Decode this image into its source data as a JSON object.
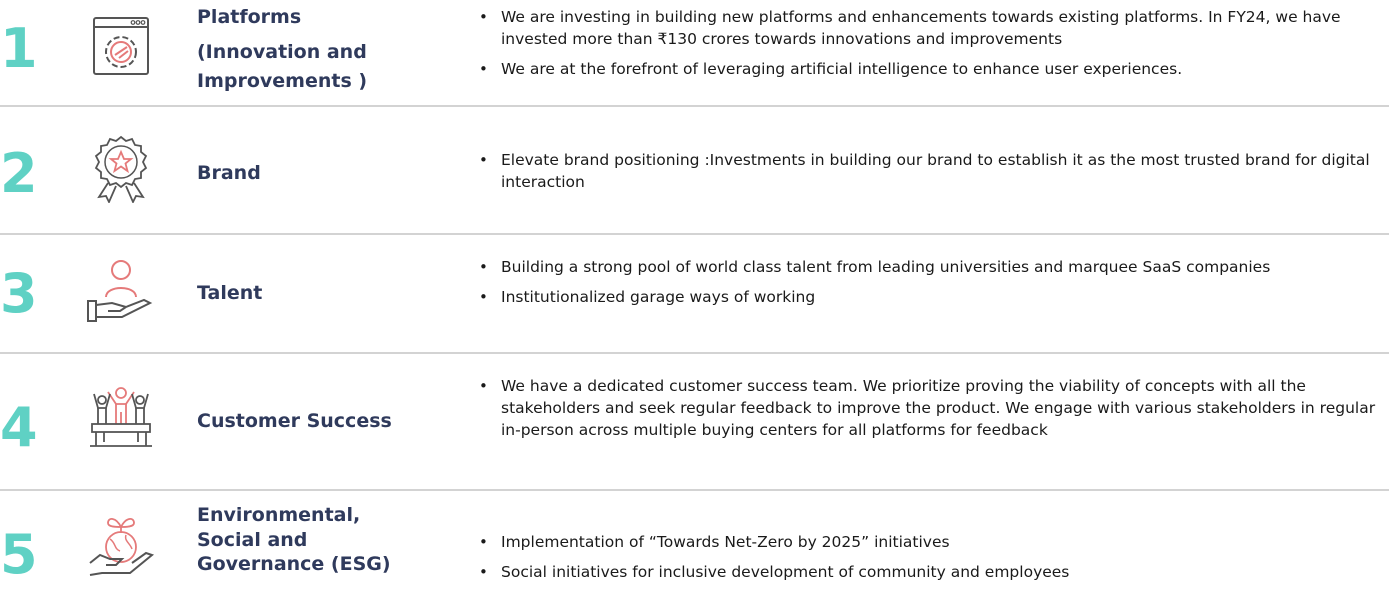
{
  "colors": {
    "number": "#5fd1c4",
    "title": "#2f3a5c",
    "icon_gray": "#555555",
    "icon_pink": "#e57a7a",
    "divider": "#d3d3d3"
  },
  "rows": [
    {
      "number": "1",
      "icon": "gear-window-icon",
      "title_lines": [
        "Platforms",
        "(Innovation and",
        "Improvements )"
      ],
      "bullets": [
        "We are investing in building new platforms and enhancements towards existing platforms. In FY24, we have invested more than ₹130 crores towards innovations and improvements",
        "We are at the forefront of leveraging artificial intelligence to enhance user experiences."
      ]
    },
    {
      "number": "2",
      "icon": "award-badge-icon",
      "title_lines": [
        "Brand"
      ],
      "bullets": [
        "Elevate brand positioning :Investments in building our brand to establish it as the most trusted brand for digital interaction"
      ]
    },
    {
      "number": "3",
      "icon": "hand-person-icon",
      "title_lines": [
        "Talent"
      ],
      "bullets": [
        "Building a strong pool of world class talent from leading universities and marquee SaaS companies",
        "Institutionalized garage ways of working"
      ]
    },
    {
      "number": "4",
      "icon": "celebrating-team-icon",
      "title_lines": [
        "Customer Success"
      ],
      "bullets": [
        "We have a dedicated customer success team. We prioritize proving the viability of concepts with all the stakeholders and seek regular feedback to improve the product.  We engage with various stakeholders in regular in-person across multiple buying centers for all platforms for feedback"
      ]
    },
    {
      "number": "5",
      "icon": "hand-globe-plant-icon",
      "title_lines": [
        "Environmental,",
        "Social and",
        "Governance (ESG)"
      ],
      "bullets": [
        "Implementation of “Towards Net-Zero by 2025” initiatives",
        "Social initiatives for inclusive development of community and employees"
      ]
    }
  ]
}
